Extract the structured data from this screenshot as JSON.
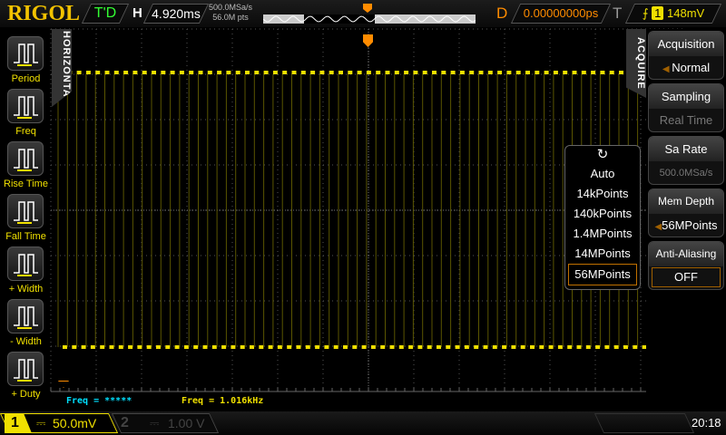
{
  "header": {
    "logo": "RIGOL",
    "run_status": "T'D",
    "h_label": "H",
    "timebase": "4.920ms",
    "sample_rate": "500.0MSa/s",
    "mem_points": "56.0M pts",
    "d_label": "D",
    "delay": "0.00000000ps",
    "t_label": "T",
    "trigger_channel": "1",
    "trigger_level": "148mV"
  },
  "left_menu": {
    "tab": "HORIZONTAL",
    "items": [
      {
        "label": "Period",
        "icon": "period-icon"
      },
      {
        "label": "Freq",
        "icon": "freq-icon"
      },
      {
        "label": "Rise Time",
        "icon": "rise-time-icon"
      },
      {
        "label": "Fall Time",
        "icon": "fall-time-icon"
      },
      {
        "label": "+ Width",
        "icon": "positive-width-icon"
      },
      {
        "label": "- Width",
        "icon": "negative-width-icon"
      },
      {
        "label": "+ Duty",
        "icon": "positive-duty-icon"
      }
    ]
  },
  "right_menu": {
    "tab": "ACQUIRE",
    "buttons": [
      {
        "title": "Acquisition",
        "value": "Normal"
      },
      {
        "title": "Sampling",
        "value": "Real Time"
      },
      {
        "title": "Sa Rate",
        "value": "500.0MSa/s"
      },
      {
        "title": "Mem Depth",
        "value": "56MPoints"
      },
      {
        "title": "Anti-Aliasing",
        "value": "OFF"
      }
    ]
  },
  "mem_depth_popup": {
    "options": [
      "Auto",
      "14kPoints",
      "140kPoints",
      "1.4MPoints",
      "14MPoints",
      "56MPoints"
    ],
    "selected": "56MPoints"
  },
  "measurements": {
    "m1": "Freq = *****",
    "m2": "Freq = 1.016kHz"
  },
  "channels": [
    {
      "num": "1",
      "scale": "50.0mV",
      "coupling": "⎓"
    },
    {
      "num": "2",
      "scale": "1.00 V",
      "coupling": "⎓"
    }
  ],
  "clock": "20:18",
  "colors": {
    "ch1": "#f0e000",
    "trigger": "#ff8c00",
    "ch2_inactive": "#555555",
    "meas1": "#00e0ff"
  }
}
